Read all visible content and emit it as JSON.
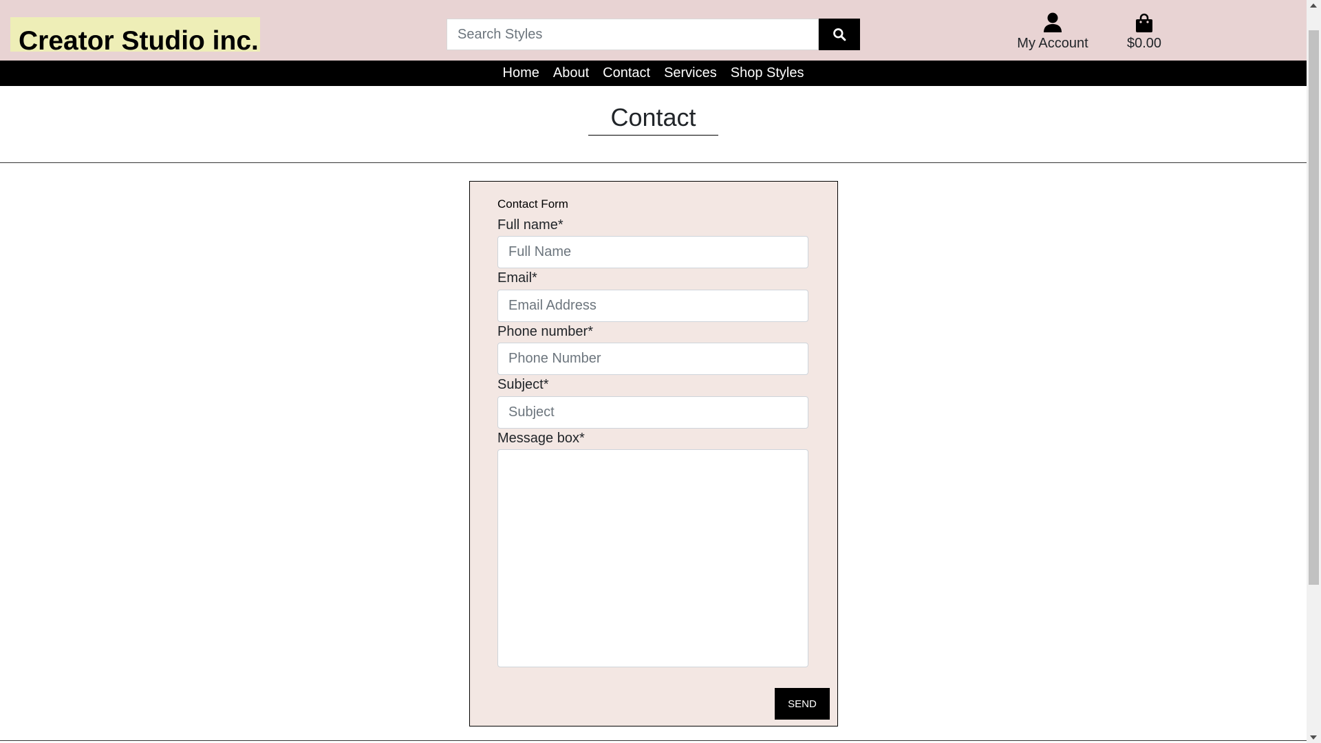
{
  "header": {
    "brand": "Creator Studio inc.",
    "search_placeholder": "Search Styles",
    "search_icon": "search-icon",
    "account_label": "My Account",
    "account_icon": "user-icon",
    "cart_total": "$0.00",
    "cart_icon": "shopping-bag-icon"
  },
  "nav": {
    "items": [
      "Home",
      "About",
      "Contact",
      "Services",
      "Shop Styles"
    ]
  },
  "page": {
    "title": "Contact"
  },
  "form": {
    "caption": "Contact Form",
    "full_name_label": "Full name*",
    "full_name_placeholder": "Full Name",
    "email_label": "Email*",
    "email_placeholder": "Email Address",
    "phone_label": "Phone number*",
    "phone_placeholder": "Phone Number",
    "subject_label": "Subject*",
    "subject_placeholder": "Subject",
    "message_label": "Message box*",
    "send_label": "SEND"
  },
  "colors": {
    "header_bg": "#e8d3d3",
    "brand_bg": "#eeeeb7",
    "nav_bg": "#000000",
    "form_bg": "#f3e7e3"
  }
}
